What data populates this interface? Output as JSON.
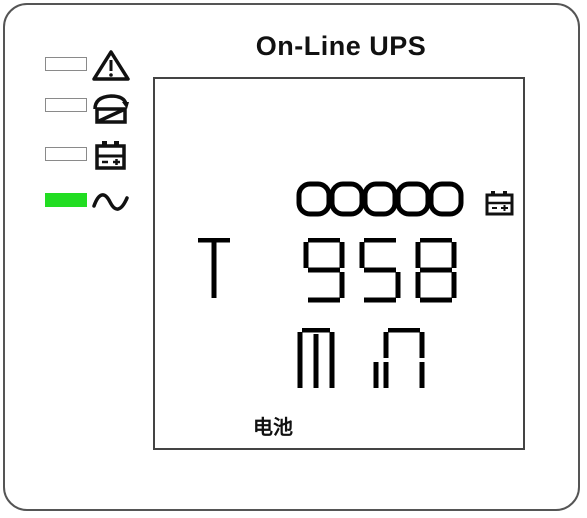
{
  "device": {
    "title": "On-Line UPS",
    "indicators": [
      {
        "name": "fault",
        "icon": "warning-triangle-icon",
        "lit": false
      },
      {
        "name": "bypass",
        "icon": "bypass-icon",
        "lit": false
      },
      {
        "name": "battery",
        "icon": "battery-icon",
        "lit": false
      },
      {
        "name": "ac-line",
        "icon": "ac-sine-wave-icon",
        "lit": true,
        "color": "#22dd22"
      }
    ]
  },
  "lcd": {
    "level_segments": "00000",
    "level_icon": "battery-icon",
    "mode_letter": "T",
    "value": "958",
    "unit": "MIN",
    "caption": "电池"
  },
  "colors": {
    "segment": "#000000",
    "led_on": "#22dd22",
    "led_off": "#ffffff"
  }
}
